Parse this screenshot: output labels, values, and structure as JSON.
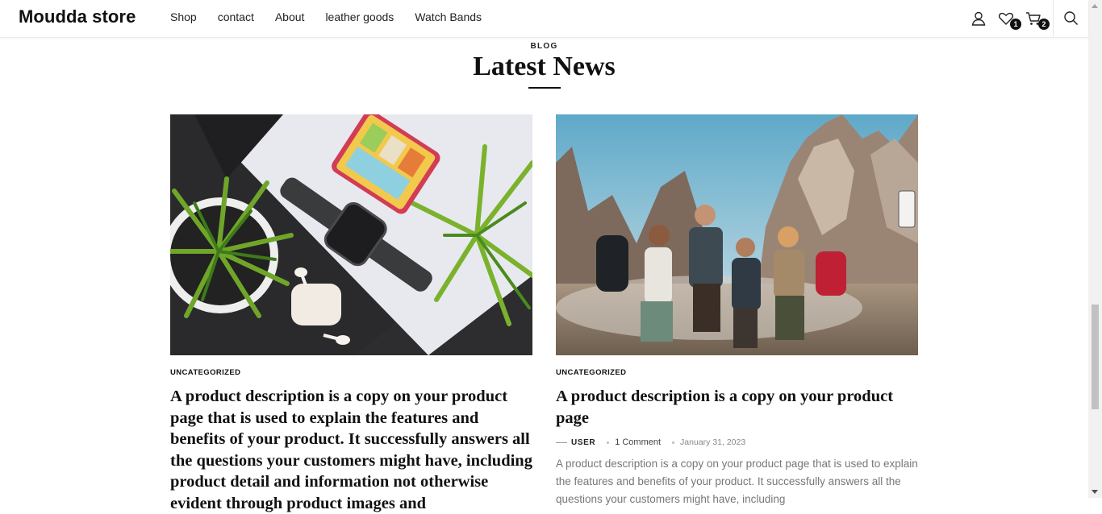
{
  "header": {
    "logo": "Moudda store",
    "nav": [
      "Shop",
      "contact",
      "About",
      "leather goods",
      "Watch Bands"
    ],
    "wishlist_count": "1",
    "cart_count": "2"
  },
  "section": {
    "eyebrow": "BLOG",
    "heading": "Latest News"
  },
  "posts": [
    {
      "category": "UNCATEGORIZED",
      "title": "A product description is a copy on your product page that is used to explain the features and benefits of your product. It successfully answers all the questions your customers might have, including product detail and information not otherwise evident through product images and",
      "image_alt": "Smartwatch, phone, earbuds and plants on desk"
    },
    {
      "category": "UNCATEGORIZED",
      "title": "A product description is a copy on your product page",
      "author": "USER",
      "comments": "1 Comment",
      "date": "January 31, 2023",
      "excerpt": "A product description is a copy on your product page that is used to explain the features and benefits of your product. It successfully answers all the questions your customers might have, including",
      "image_alt": "Group of hikers in the mountains"
    }
  ],
  "colors": {
    "text": "#111111",
    "muted": "#777777",
    "badge": "#111111"
  },
  "icons": [
    "user-icon",
    "heart-icon",
    "cart-icon",
    "search-icon"
  ]
}
